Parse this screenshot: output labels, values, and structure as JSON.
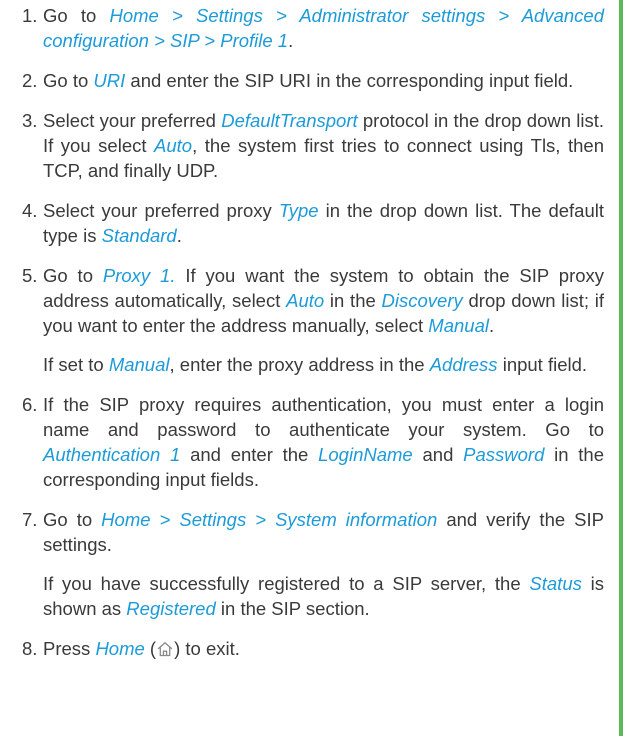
{
  "colors": {
    "link": "#1c9bd8",
    "text": "#3a3a3a",
    "side_bar": "#5cb85c"
  },
  "steps": [
    {
      "num": "1.",
      "paragraphs": [
        [
          {
            "t": "Go to "
          },
          {
            "t": "Home > Settings > Administrator settings > Advanced configuration > SIP > Profile 1",
            "hl": true
          },
          {
            "t": "."
          }
        ]
      ]
    },
    {
      "num": "2.",
      "paragraphs": [
        [
          {
            "t": "Go to "
          },
          {
            "t": "URI",
            "hl": true
          },
          {
            "t": " and enter the SIP URI in the corresponding input field."
          }
        ]
      ]
    },
    {
      "num": "3.",
      "paragraphs": [
        [
          {
            "t": "Select your preferred "
          },
          {
            "t": "DefaultTransport",
            "hl": true
          },
          {
            "t": " protocol in the drop down list. If you select "
          },
          {
            "t": "Auto",
            "hl": true
          },
          {
            "t": ", the system first tries to connect using Tls, then TCP, and finally UDP."
          }
        ]
      ]
    },
    {
      "num": "4.",
      "paragraphs": [
        [
          {
            "t": "Select your preferred proxy "
          },
          {
            "t": "Type",
            "hl": true
          },
          {
            "t": " in the drop down list. The default type is "
          },
          {
            "t": "Standard",
            "hl": true
          },
          {
            "t": "."
          }
        ]
      ]
    },
    {
      "num": "5.",
      "paragraphs": [
        [
          {
            "t": "Go to "
          },
          {
            "t": "Proxy 1.",
            "hl": true
          },
          {
            "t": " If you want the system to obtain the SIP proxy address automatically, select "
          },
          {
            "t": "Auto",
            "hl": true
          },
          {
            "t": " in the "
          },
          {
            "t": "Discovery",
            "hl": true
          },
          {
            "t": " drop down list; if you want to enter the address manually, select "
          },
          {
            "t": "Manual",
            "hl": true
          },
          {
            "t": "."
          }
        ],
        [
          {
            "t": "If set to "
          },
          {
            "t": "Manual",
            "hl": true
          },
          {
            "t": ", enter the proxy address in the "
          },
          {
            "t": "Address",
            "hl": true
          },
          {
            "t": " input field."
          }
        ]
      ]
    },
    {
      "num": "6.",
      "paragraphs": [
        [
          {
            "t": "If the SIP proxy requires authentication, you must enter a login name and password to authenticate your system. Go to "
          },
          {
            "t": "Authentication 1",
            "hl": true
          },
          {
            "t": " and enter the "
          },
          {
            "t": "LoginName",
            "hl": true
          },
          {
            "t": " and "
          },
          {
            "t": "Password",
            "hl": true
          },
          {
            "t": " in the corresponding input fields."
          }
        ]
      ]
    },
    {
      "num": "7.",
      "paragraphs": [
        [
          {
            "t": "Go to "
          },
          {
            "t": "Home > Settings > System information",
            "hl": true
          },
          {
            "t": " and verify the SIP settings."
          }
        ],
        [
          {
            "t": "If you have successfully registered to a SIP server, the "
          },
          {
            "t": "Status",
            "hl": true
          },
          {
            "t": " is shown as "
          },
          {
            "t": "Registered",
            "hl": true
          },
          {
            "t": " in the SIP section."
          }
        ]
      ]
    },
    {
      "num": "8.",
      "paragraphs": [
        [
          {
            "t": "Press "
          },
          {
            "t": "Home",
            "hl": true
          },
          {
            "t": " ("
          },
          {
            "icon": "home-icon"
          },
          {
            "t": ") to exit."
          }
        ]
      ]
    }
  ]
}
